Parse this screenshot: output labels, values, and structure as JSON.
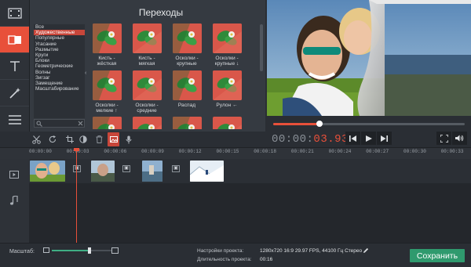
{
  "panel": {
    "title": "Переходы",
    "categories": [
      "Все",
      "Художественные",
      "Популярные",
      "Угасание",
      "Размытие",
      "Круги",
      "Блоки",
      "Геометрические",
      "Волны",
      "Зигзаг",
      "Замещение",
      "Масштабирование"
    ],
    "selected_category": "Художественные",
    "transitions": [
      {
        "label_1": "Кисть -",
        "label_2": "жёсткая"
      },
      {
        "label_1": "Кисть -",
        "label_2": "мягкая"
      },
      {
        "label_1": "Осколки -",
        "label_2": "крупные"
      },
      {
        "label_1": "Осколки -",
        "label_2": "крупные ↓"
      },
      {
        "label_1": "Осколки -",
        "label_2": "мелкие ↑"
      },
      {
        "label_1": "Осколки -",
        "label_2": "средние"
      },
      {
        "label_1": "Распад",
        "label_2": ""
      },
      {
        "label_1": "Рулон ←",
        "label_2": ""
      }
    ]
  },
  "player": {
    "timecode_dim": "00:00:",
    "timecode_active": "03.930",
    "progress": 0.24
  },
  "timeline": {
    "ticks": [
      "00:00:00",
      "00:00:03",
      "00:00:06",
      "00:00:09",
      "00:00:12",
      "00:00:15",
      "00:00:18",
      "00:00:21",
      "00:00:24",
      "00:00:27",
      "00:00:30",
      "00:00:33"
    ]
  },
  "bottom": {
    "scale_label": "Масштаб:",
    "zoom_level": 0.63,
    "settings_label": "Настройки проекта:",
    "settings_value": "1280x720 16:9 29.97 FPS, 44100 Гц Стерео",
    "duration_label": "Длительность проекта:",
    "duration_value": "00:16",
    "save_label": "Сохранить"
  },
  "colors": {
    "accent": "#e8503a",
    "save_green": "#2f9a6e",
    "zoom_green": "#3fae84"
  }
}
